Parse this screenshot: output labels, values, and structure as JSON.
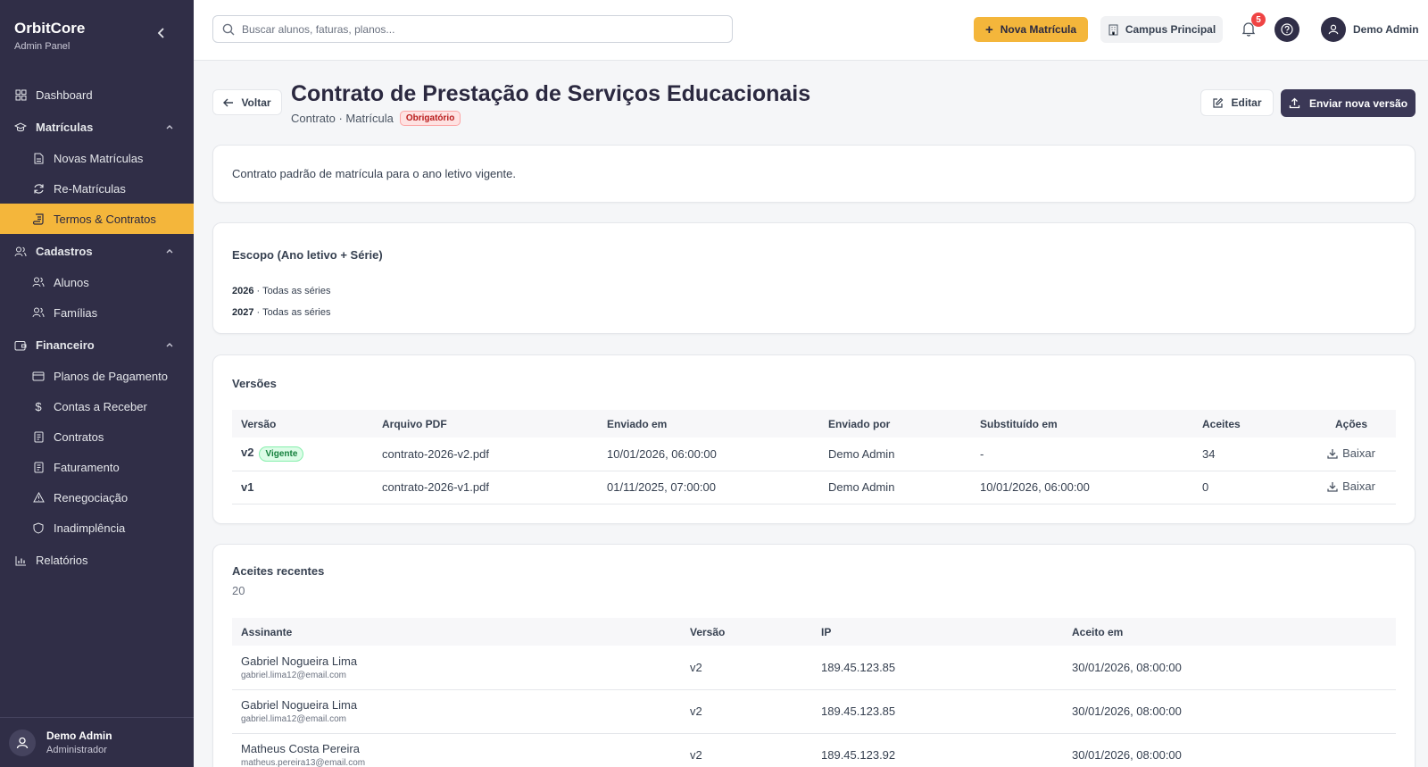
{
  "brand": {
    "title": "OrbitCore",
    "subtitle": "Admin Panel"
  },
  "sidebar": {
    "dashboard": "Dashboard",
    "matriculas": {
      "label": "Matrículas",
      "items": [
        "Novas Matrículas",
        "Re-Matrículas",
        "Termos & Contratos"
      ]
    },
    "cadastros": {
      "label": "Cadastros",
      "items": [
        "Alunos",
        "Famílias"
      ]
    },
    "financeiro": {
      "label": "Financeiro",
      "items": [
        "Planos de Pagamento",
        "Contas a Receber",
        "Contratos",
        "Faturamento",
        "Renegociação",
        "Inadimplência"
      ]
    },
    "relatorios": "Relatórios",
    "active_item": "Termos & Contratos",
    "footer": {
      "name": "Demo Admin",
      "role": "Administrador"
    }
  },
  "topbar": {
    "search_placeholder": "Buscar alunos, faturas, planos...",
    "new_button": "Nova Matrícula",
    "campus_button": "Campus Principal",
    "notifications_count": "5",
    "user_name": "Demo Admin"
  },
  "page": {
    "back_label": "Voltar",
    "title": "Contrato de Prestação de Serviços Educacionais",
    "meta": "Contrato · Matrícula",
    "required_tag": "Obrigatório",
    "edit_label": "Editar",
    "upload_label": "Enviar nova versão",
    "description": "Contrato padrão de matrícula para o ano letivo vigente."
  },
  "scope": {
    "title": "Escopo (Ano letivo + Série)",
    "entries": [
      {
        "year": "2026",
        "grades": "· Todas as séries"
      },
      {
        "year": "2027",
        "grades": "· Todas as séries"
      }
    ]
  },
  "versions": {
    "title": "Versões",
    "columns": [
      "Versão",
      "Arquivo PDF",
      "Enviado em",
      "Enviado por",
      "Substituído em",
      "Aceites",
      "Ações"
    ],
    "rows": [
      {
        "version": "v2",
        "tag": "Vigente",
        "file": "contrato-2026-v2.pdf",
        "sent_at": "10/01/2026, 06:00:00",
        "sent_by": "Demo Admin",
        "replaced_at": "-",
        "accepts": "34",
        "action": "Baixar"
      },
      {
        "version": "v1",
        "tag": "",
        "file": "contrato-2026-v1.pdf",
        "sent_at": "01/11/2025, 07:00:00",
        "sent_by": "Demo Admin",
        "replaced_at": "10/01/2026, 06:00:00",
        "accepts": "0",
        "action": "Baixar"
      }
    ]
  },
  "accepts": {
    "title": "Aceites recentes",
    "count": "20",
    "columns": [
      "Assinante",
      "Versão",
      "IP",
      "Aceito em"
    ],
    "rows": [
      {
        "name": "Gabriel Nogueira Lima",
        "email": "gabriel.lima12@email.com",
        "version": "v2",
        "ip": "189.45.123.85",
        "accepted_at": "30/01/2026, 08:00:00"
      },
      {
        "name": "Gabriel Nogueira Lima",
        "email": "gabriel.lima12@email.com",
        "version": "v2",
        "ip": "189.45.123.85",
        "accepted_at": "30/01/2026, 08:00:00"
      },
      {
        "name": "Matheus Costa Pereira",
        "email": "matheus.pereira13@email.com",
        "version": "v2",
        "ip": "189.45.123.92",
        "accepted_at": "30/01/2026, 08:00:00"
      }
    ]
  },
  "colors": {
    "sidebar_bg": "#302e47",
    "accent": "#f4b63b",
    "primary_button": "#3b3856",
    "danger": "#ef4444",
    "success": "#15803d"
  }
}
